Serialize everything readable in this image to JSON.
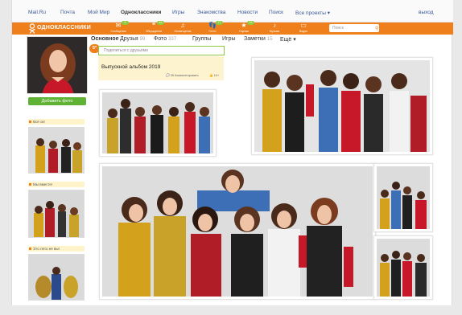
{
  "topbar": {
    "links": [
      "Mail.Ru",
      "Почта",
      "Мой Мир",
      "Одноклассники",
      "Игры",
      "Знакомства",
      "Новости",
      "Поиск",
      "Все проекты ▾"
    ],
    "exit": "выход"
  },
  "header": {
    "logo_text": "ОДНОКЛАССНИКИ",
    "nav": [
      {
        "icon": "envelope-icon",
        "label": "Сообщения",
        "badge": "5"
      },
      {
        "icon": "discussion-icon",
        "label": "Обсуждения",
        "badge": "46"
      },
      {
        "icon": "bell-icon",
        "label": "Оповещения",
        "badge": ""
      },
      {
        "icon": "footprints-icon",
        "label": "Гости",
        "badge": "77"
      },
      {
        "icon": "star-icon",
        "label": "Оценки",
        "badge": "33"
      },
      {
        "icon": "music-icon",
        "label": "Музыка",
        "badge": ""
      },
      {
        "icon": "video-icon",
        "label": "Видео",
        "badge": ""
      }
    ],
    "search_placeholder": "Поиск"
  },
  "colors": {
    "brand_orange": "#ef7f1a",
    "green": "#5fb233",
    "album_bg": "#fdf3cf"
  },
  "profile": {
    "tabs": [
      {
        "label": "Основное",
        "count": ""
      },
      {
        "label": "Друзья",
        "count": "99"
      },
      {
        "label": "Фото",
        "count": "337"
      },
      {
        "label": "Группы",
        "count": ""
      },
      {
        "label": "Игры",
        "count": ""
      },
      {
        "label": "Заметки",
        "count": "15"
      },
      {
        "label": "Ещё ▾",
        "count": ""
      }
    ],
    "post_placeholder": "Поделиться с друзьями",
    "badge": "5*",
    "add_photo": "Добавить фото"
  },
  "album": {
    "title": "Выпускной альбом 2019",
    "comments": "35 Комментировать",
    "likes": "10+"
  },
  "sidebar": {
    "headings": [
      "Всё ок!",
      "Мы вместе!",
      "Это лето не вы!"
    ]
  }
}
